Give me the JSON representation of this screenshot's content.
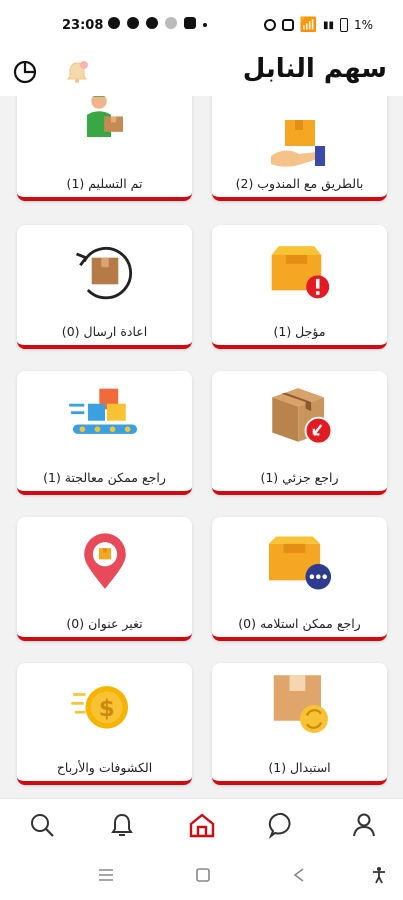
{
  "status_bar": {
    "time": "23:08",
    "battery": "1%"
  },
  "header": {
    "title": "سهم النابل"
  },
  "cards": [
    {
      "label": "بالطريق مع المندوب (2)",
      "icon": "hand-with-box-icon"
    },
    {
      "label": "تم التسليم (1)",
      "icon": "delivery-person-icon"
    },
    {
      "label": "مؤجل (1)",
      "icon": "box-alert-icon"
    },
    {
      "label": "اعادة ارسال (0)",
      "icon": "box-resend-icon"
    },
    {
      "label": "راجع جزئي (1)",
      "icon": "box-return-icon"
    },
    {
      "label": "راجع ممكن معالجتة (1)",
      "icon": "conveyor-boxes-icon"
    },
    {
      "label": "راجع ممكن استلامه (0)",
      "icon": "box-pending-icon"
    },
    {
      "label": "تغير عنوان (0)",
      "icon": "location-pin-icon"
    },
    {
      "label": "استبدال (1)",
      "icon": "box-exchange-icon"
    },
    {
      "label": "الكشوفات والأرباح",
      "icon": "dollar-coin-icon"
    }
  ],
  "bottom_nav": [
    "search-icon",
    "bell-icon",
    "home-icon",
    "chat-icon",
    "profile-icon"
  ],
  "colors": {
    "accent": "#d10a11",
    "background": "#f2f2f2"
  }
}
